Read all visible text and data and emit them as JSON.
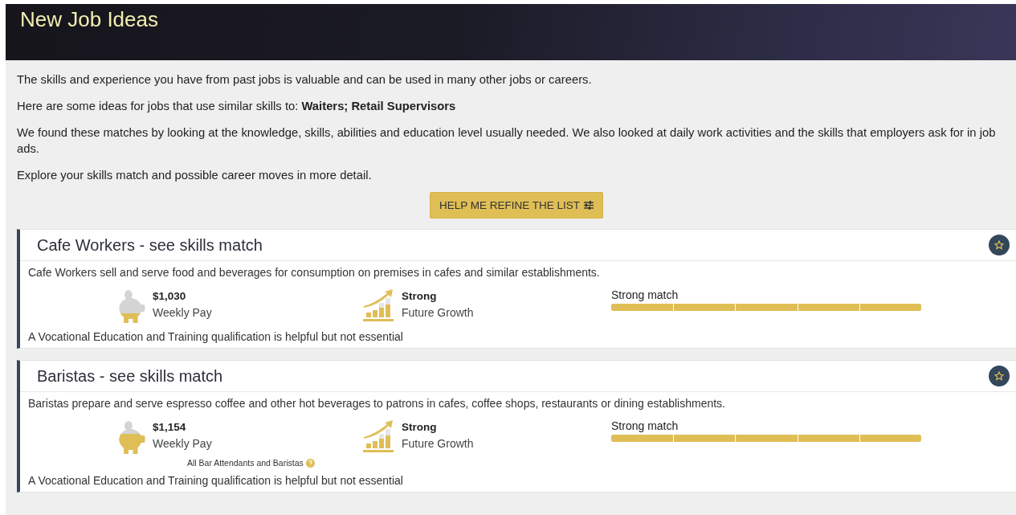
{
  "header": {
    "title": "New Job Ideas"
  },
  "intro": [
    "The skills and experience you have from past jobs is valuable and can be used in many other jobs or careers.",
    "Here are some ideas for jobs that use similar skills to: **Waiters; Retail Supervisors**",
    "We found these matches by looking at the knowledge, skills, abilities and education level usually needed. We also looked at daily work activities and the skills that employers ask for in job ads.",
    "Explore your skills match and possible career moves in more detail."
  ],
  "refine_button": "HELP ME REFINE THE LIST",
  "jobs": [
    {
      "title": "Cafe Workers - see skills match",
      "description": "Cafe Workers sell and serve food and beverages for consumption on premises in cafes and similar establishments.",
      "pay": {
        "value": "$1,030",
        "label": "Weekly Pay",
        "level": 0.3
      },
      "growth": {
        "value": "Strong",
        "label": "Future Growth"
      },
      "match": {
        "label": "Strong match",
        "level": 1
      },
      "qualification": "A Vocational Education and Training qualification is helpful but not essential"
    },
    {
      "title": "Baristas - see skills match",
      "description": "Baristas prepare and serve espresso coffee and other hot beverages to patrons in cafes, coffee shops, restaurants or dining establishments.",
      "pay": {
        "value": "$1,154",
        "label": "Weekly Pay",
        "level": 0.6,
        "note": "All Bar Attendants and Baristas"
      },
      "growth": {
        "value": "Strong",
        "label": "Future Growth"
      },
      "match": {
        "label": "Strong match",
        "level": 1
      },
      "qualification": "A Vocational Education and Training qualification is helpful but not essential"
    }
  ]
}
